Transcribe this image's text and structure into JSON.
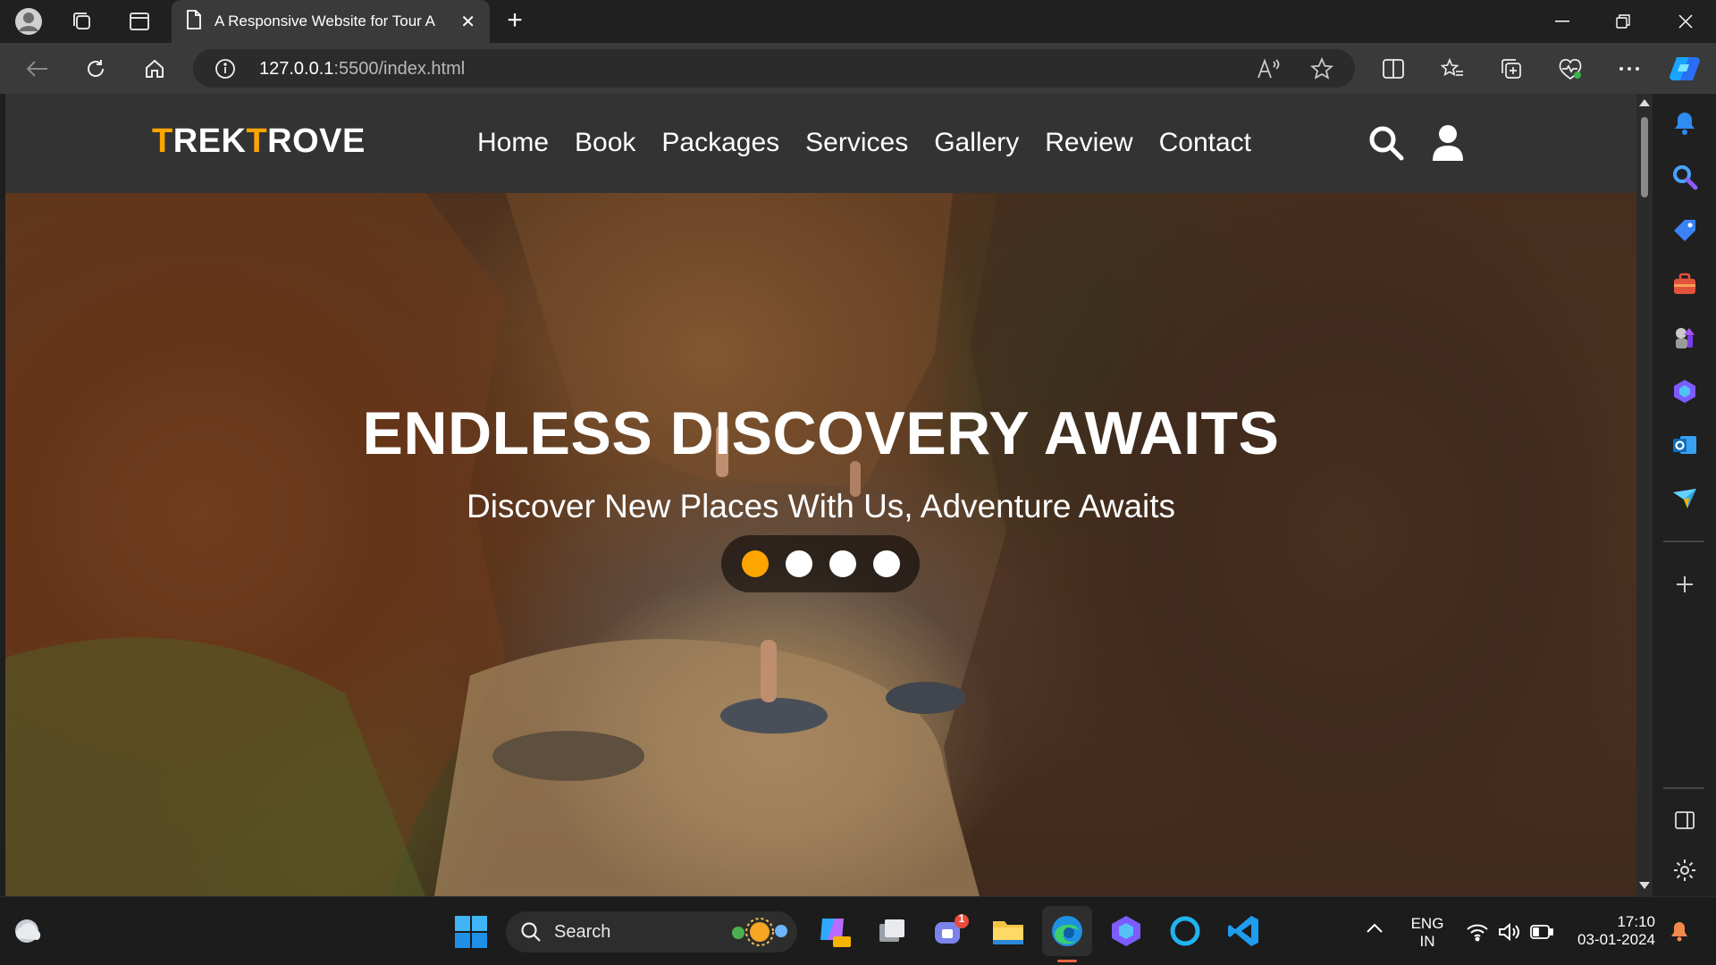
{
  "browser": {
    "tab_title": "A Responsive Website for Tour A",
    "url_host": "127.0.0.1",
    "url_rest": ":5500/index.html"
  },
  "site": {
    "logo_part1": "T",
    "logo_part2": "REK",
    "logo_part3": "T",
    "logo_part4": "ROVE",
    "nav": [
      "Home",
      "Book",
      "Packages",
      "Services",
      "Gallery",
      "Review",
      "Contact"
    ],
    "hero_title": "ENDLESS DISCOVERY AWAITS",
    "hero_subtitle": "Discover New Places With Us, Adventure Awaits",
    "slider_dots": 4,
    "active_dot": 1,
    "accent_color": "#ffa500"
  },
  "taskbar": {
    "search_label": "Search",
    "lang_line1": "ENG",
    "lang_line2": "IN",
    "time": "17:10",
    "date": "03-01-2024",
    "teams_badge": "1"
  }
}
